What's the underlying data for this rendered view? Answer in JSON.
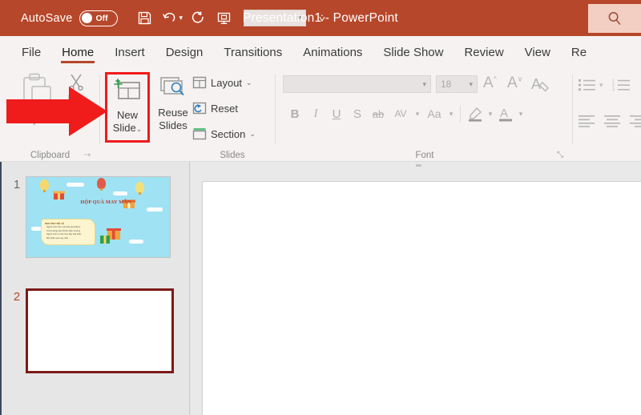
{
  "app": {
    "document_title": "Presentation1  -  PowerPoint",
    "brand_color": "#b7472a",
    "highlight_color": "#f01b1b"
  },
  "titlebar": {
    "autosave_label": "AutoSave",
    "autosave_state": "Off",
    "quick_access": [
      {
        "name": "save-icon",
        "label": "Save"
      },
      {
        "name": "undo-icon",
        "label": "Undo"
      },
      {
        "name": "redo-icon",
        "label": "Redo"
      },
      {
        "name": "start-presentation-icon",
        "label": "Start From Beginning"
      }
    ],
    "qat_customize_value": "",
    "ribbon_display_options": "⩒",
    "search_icon": "search-icon"
  },
  "tabs": [
    {
      "label": "File",
      "active": false
    },
    {
      "label": "Home",
      "active": true
    },
    {
      "label": "Insert",
      "active": false
    },
    {
      "label": "Design",
      "active": false
    },
    {
      "label": "Transitions",
      "active": false
    },
    {
      "label": "Animations",
      "active": false
    },
    {
      "label": "Slide Show",
      "active": false
    },
    {
      "label": "Review",
      "active": false
    },
    {
      "label": "View",
      "active": false
    },
    {
      "label": "Re",
      "active": false
    }
  ],
  "ribbon": {
    "groups": [
      {
        "label": "Clipboard"
      },
      {
        "label": "Slides"
      },
      {
        "label": "Font"
      }
    ],
    "clipboard": {
      "paste_label": "",
      "cut_label": "",
      "copy_label": "",
      "format_painter_label": ""
    },
    "slides": {
      "new_slide_line1": "New",
      "new_slide_line2": "Slide",
      "new_slide_caret": "⌄",
      "reuse_line1": "Reuse",
      "reuse_line2": "Slides",
      "layout_label": "Layout",
      "layout_caret": "⌄",
      "reset_label": "Reset",
      "section_label": "Section",
      "section_caret": "⌄"
    },
    "font": {
      "font_name_value": "",
      "font_size_value": "18",
      "bold": "B",
      "italic": "I",
      "underline": "U",
      "shadow": "S",
      "strikethrough": "ab",
      "character_spacing": "AV",
      "change_case": "Aa",
      "grow_font": "A",
      "shrink_font": "A",
      "clear_formatting": "A",
      "text_highlight": "A",
      "font_color": "A",
      "dialog_launcher": "⤡"
    }
  },
  "thumbnails": [
    {
      "number": "1",
      "selected": false,
      "slide_title": "HỘP QUÀ MAY MẮN",
      "banner_heading": "MỌI TÌM THÊ LỆ",
      "banner_lines": [
        "Người chơi chọn một hộp quà bất kỳ",
        "Trả lời đúng câu hỏi để nhận thưởng",
        "Người chơi có thể chọn tiếp hộp khác",
        "Mỗi phần quà may mắn"
      ]
    },
    {
      "number": "2",
      "selected": true,
      "slide_title": "",
      "banner_heading": "",
      "banner_lines": []
    }
  ],
  "annotation": {
    "arrow_name": "red-arrow-pointer",
    "arrow_color": "#f01b1b",
    "highlight_target": "New Slide"
  }
}
